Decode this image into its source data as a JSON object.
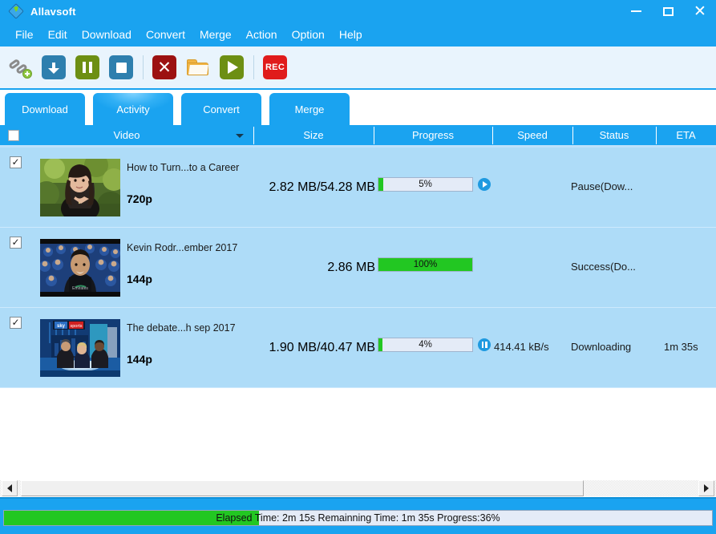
{
  "window": {
    "title": "Allavsoft",
    "icon": "app-diamond-download-icon",
    "controls": {
      "minimize": "–",
      "maximize": "☐",
      "close": "✕"
    }
  },
  "menu": {
    "items": [
      "File",
      "Edit",
      "Download",
      "Convert",
      "Merge",
      "Action",
      "Option",
      "Help"
    ]
  },
  "toolbar": {
    "buttons": [
      {
        "name": "add-url-button",
        "icon": "link-add-icon",
        "label": ""
      },
      {
        "name": "download-button",
        "icon": "download-arrow-icon",
        "label": ""
      },
      {
        "name": "pause-button",
        "icon": "pause-icon",
        "label": ""
      },
      {
        "name": "stop-button",
        "icon": "stop-icon",
        "label": ""
      },
      {
        "name": "delete-button",
        "icon": "close-x-icon",
        "label": ""
      },
      {
        "name": "open-folder-button",
        "icon": "folder-icon",
        "label": ""
      },
      {
        "name": "play-button",
        "icon": "play-icon",
        "label": ""
      },
      {
        "name": "record-button",
        "icon": "record-icon",
        "label": "REC"
      }
    ]
  },
  "tabs": [
    {
      "label": "Download",
      "active": false
    },
    {
      "label": "Activity",
      "active": true
    },
    {
      "label": "Convert",
      "active": false
    },
    {
      "label": "Merge",
      "active": false
    }
  ],
  "columns": {
    "video": "Video",
    "size": "Size",
    "progress": "Progress",
    "speed": "Speed",
    "status": "Status",
    "eta": "ETA",
    "select_all_checked": false
  },
  "rows": [
    {
      "checked": true,
      "check_mark": "✓",
      "title": "How to Turn...to a Career",
      "resolution": "720p",
      "size": "2.82 MB/54.28 MB",
      "progress_text": "5%",
      "progress_pct": 5,
      "control_icon": "play-circle-icon",
      "speed": "",
      "status": "Pause(Dow...",
      "eta": "",
      "thumb": "woman-outdoors-portrait"
    },
    {
      "checked": true,
      "check_mark": "✓",
      "title": "Kevin Rodr...ember 2017",
      "resolution": "144p",
      "size": "2.86 MB",
      "progress_text": "100%",
      "progress_pct": 100,
      "control_icon": "",
      "speed": "",
      "status": "Success(Do...",
      "eta": "",
      "thumb": "football-player-crowd"
    },
    {
      "checked": true,
      "check_mark": "✓",
      "title": "The debate...h sep 2017",
      "resolution": "144p",
      "size": "1.90 MB/40.47 MB",
      "progress_text": "4%",
      "progress_pct": 4,
      "control_icon": "pause-circle-icon",
      "speed": "414.41 kB/s",
      "status": "Downloading",
      "eta": "1m 35s",
      "thumb": "sky-sports-studio"
    }
  ],
  "statusbar": {
    "text": "Elapsed Time: 2m 15s Remainning Time: 1m 35s Progress:36%",
    "progress_pct": 36
  },
  "colors": {
    "accent_blue": "#1aa3f0",
    "row_blue": "#aedcf8",
    "progress_green": "#22c722",
    "toolbar_bg": "#e9f4fd"
  }
}
